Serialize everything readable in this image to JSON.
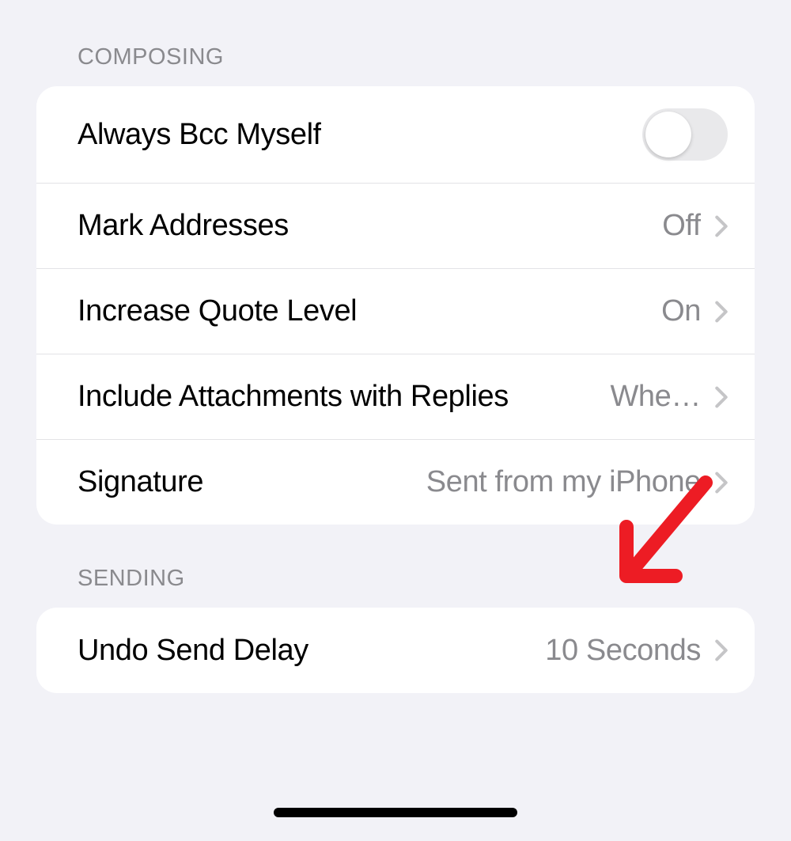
{
  "sections": {
    "composing": {
      "header": "COMPOSING",
      "rows": {
        "bcc": {
          "label": "Always Bcc Myself"
        },
        "mark": {
          "label": "Mark Addresses",
          "value": "Off"
        },
        "quote": {
          "label": "Increase Quote Level",
          "value": "On"
        },
        "attach": {
          "label": "Include Attachments with Replies",
          "value": "Whe…"
        },
        "signature": {
          "label": "Signature",
          "value": "Sent from my iPhone"
        }
      }
    },
    "sending": {
      "header": "SENDING",
      "rows": {
        "undo": {
          "label": "Undo Send Delay",
          "value": "10 Seconds"
        }
      }
    }
  },
  "annotation": {
    "arrow_color": "#ed1c24"
  }
}
